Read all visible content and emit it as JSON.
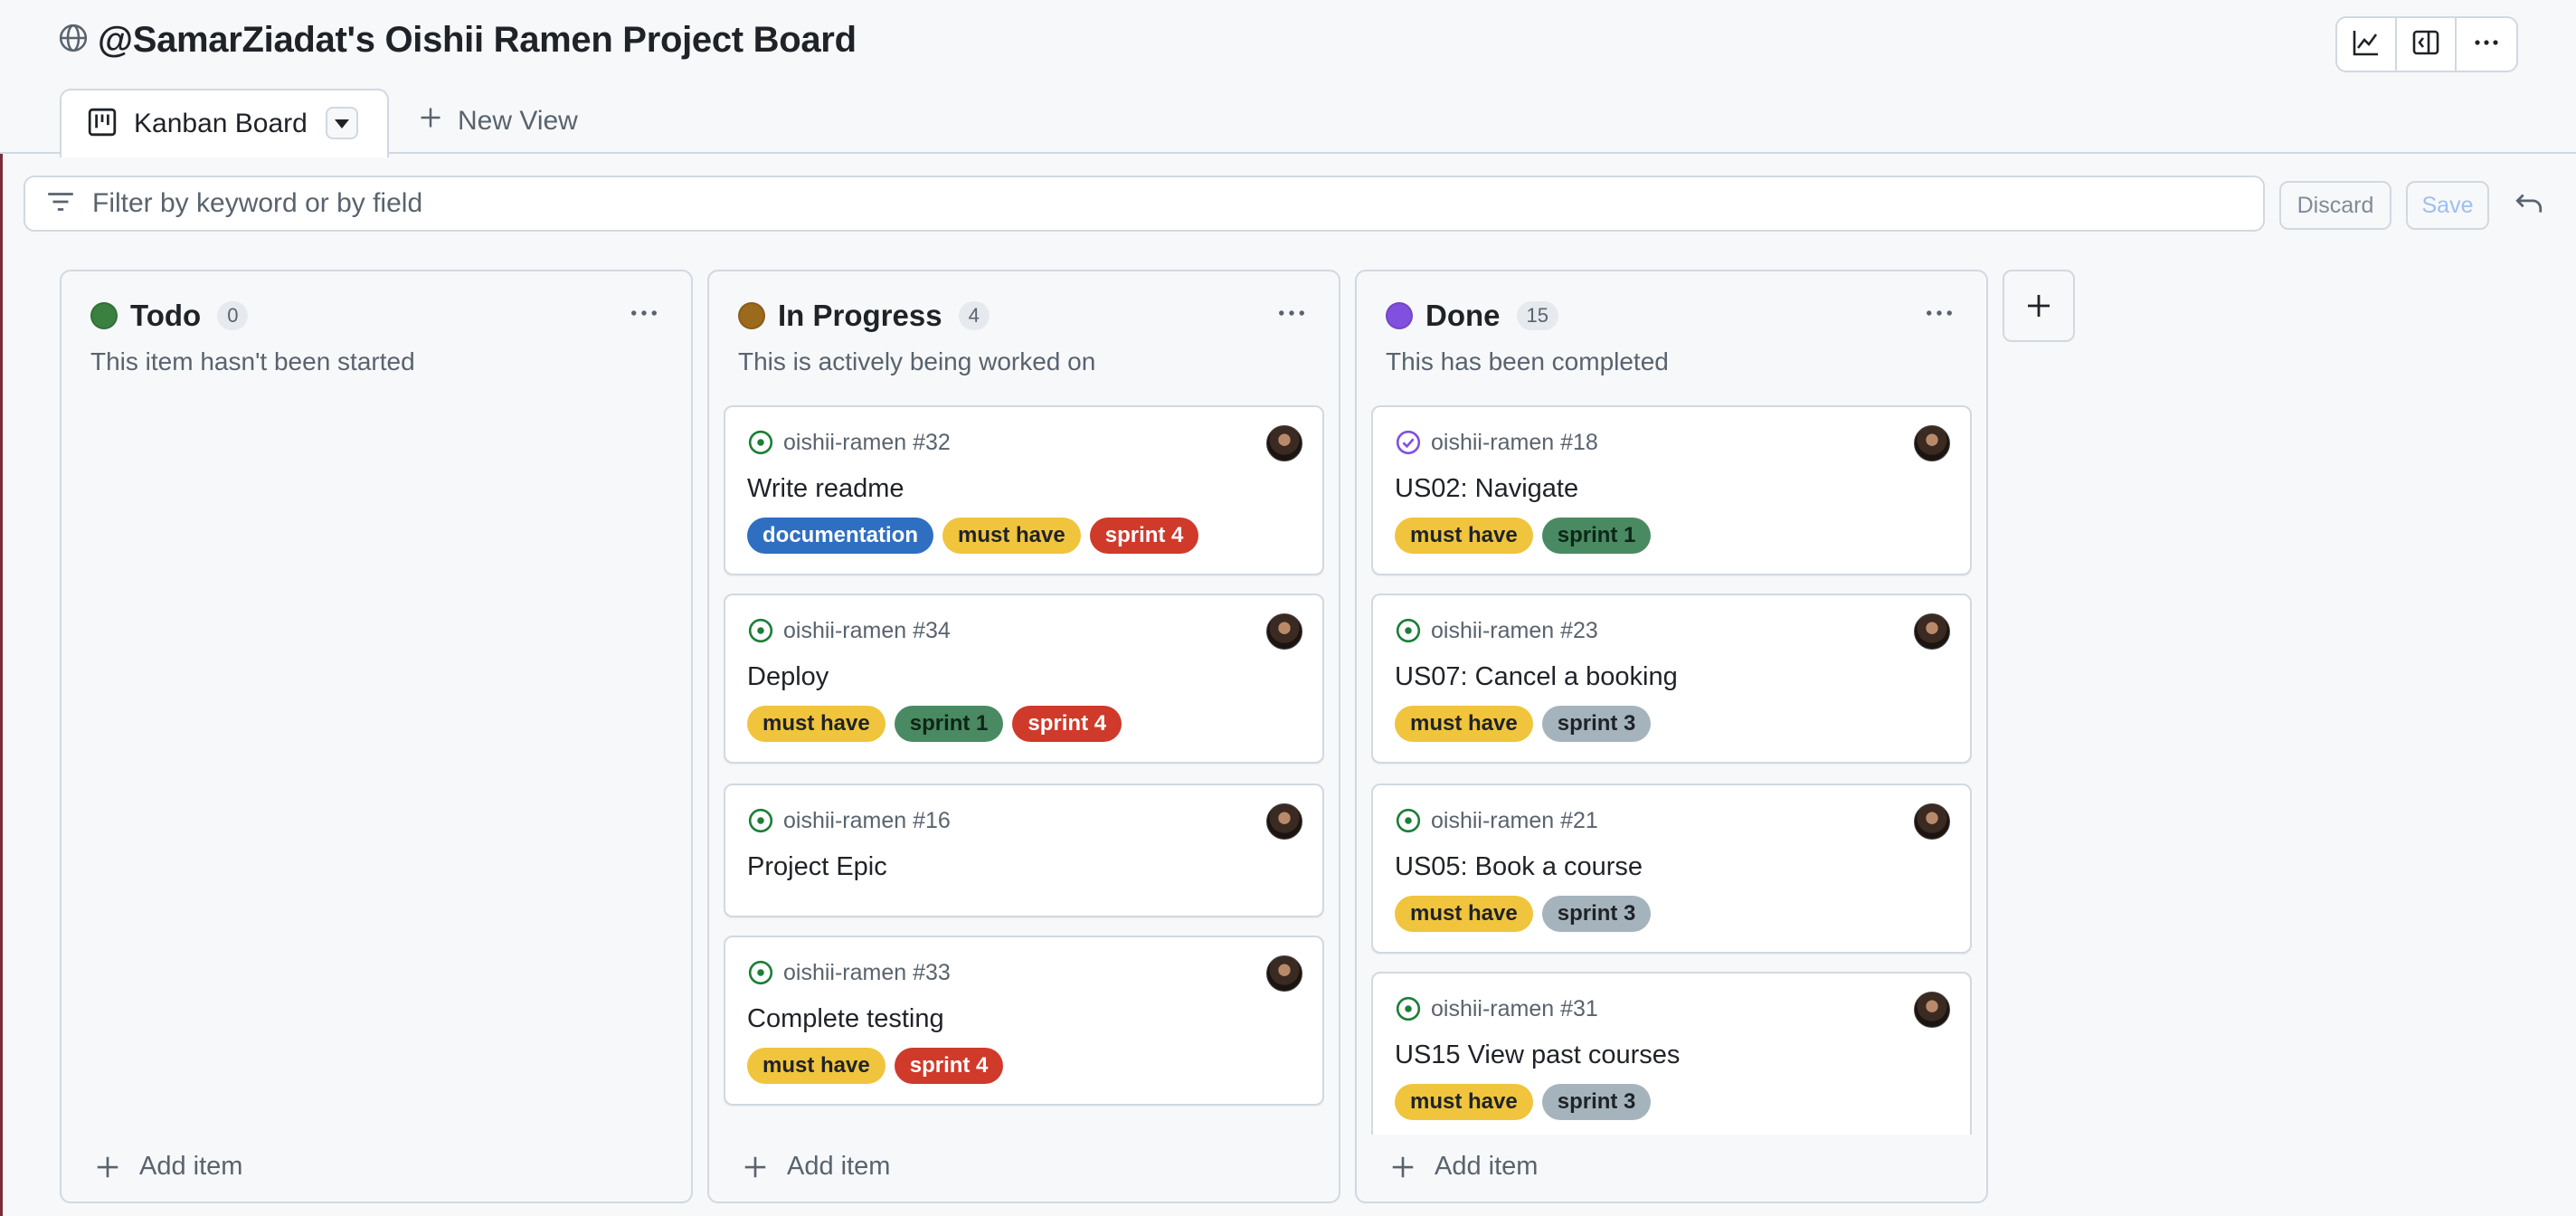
{
  "header": {
    "title": "@SamarZiadat's Oishii Ramen Project Board",
    "icons": [
      "globe-icon",
      "graph-icon",
      "sidebar-expand-icon",
      "kebab-icon"
    ]
  },
  "tabs": {
    "active_label": "Kanban Board",
    "new_view_label": "New View"
  },
  "filter": {
    "placeholder": "Filter by keyword or by field",
    "discard_label": "Discard",
    "save_label": "Save"
  },
  "colors": {
    "todo": "#3a8040",
    "in_progress": "#9c6a1c",
    "done": "#8250df",
    "documentation": "#2f6fc1",
    "must_have": "#f0c43c",
    "sprint1": "#4a8a62",
    "sprint3": "#a5b4bc",
    "sprint4": "#cf3a2b"
  },
  "columns": [
    {
      "name": "Todo",
      "count": "0",
      "description": "This item hasn't been started",
      "add_label": "Add item",
      "cards": []
    },
    {
      "name": "In Progress",
      "count": "4",
      "description": "This is actively being worked on",
      "add_label": "Add item",
      "cards": [
        {
          "ref": "oishii-ramen #32",
          "title": "Write readme",
          "status": "open",
          "labels": [
            "documentation",
            "must have",
            "sprint 4"
          ]
        },
        {
          "ref": "oishii-ramen #34",
          "title": "Deploy",
          "status": "open",
          "labels": [
            "must have",
            "sprint 1",
            "sprint 4"
          ]
        },
        {
          "ref": "oishii-ramen #16",
          "title": "Project Epic",
          "status": "open",
          "labels": []
        },
        {
          "ref": "oishii-ramen #33",
          "title": "Complete testing",
          "status": "open",
          "labels": [
            "must have",
            "sprint 4"
          ]
        }
      ]
    },
    {
      "name": "Done",
      "count": "15",
      "description": "This has been completed",
      "add_label": "Add item",
      "cards": [
        {
          "ref": "oishii-ramen #18",
          "title": "US02: Navigate",
          "status": "closed",
          "labels": [
            "must have",
            "sprint 1"
          ]
        },
        {
          "ref": "oishii-ramen #23",
          "title": "US07: Cancel a booking",
          "status": "open",
          "labels": [
            "must have",
            "sprint 3"
          ]
        },
        {
          "ref": "oishii-ramen #21",
          "title": "US05: Book a course",
          "status": "open",
          "labels": [
            "must have",
            "sprint 3"
          ]
        },
        {
          "ref": "oishii-ramen #31",
          "title": "US15 View past courses",
          "status": "open",
          "labels": [
            "must have",
            "sprint 3"
          ]
        }
      ]
    }
  ]
}
